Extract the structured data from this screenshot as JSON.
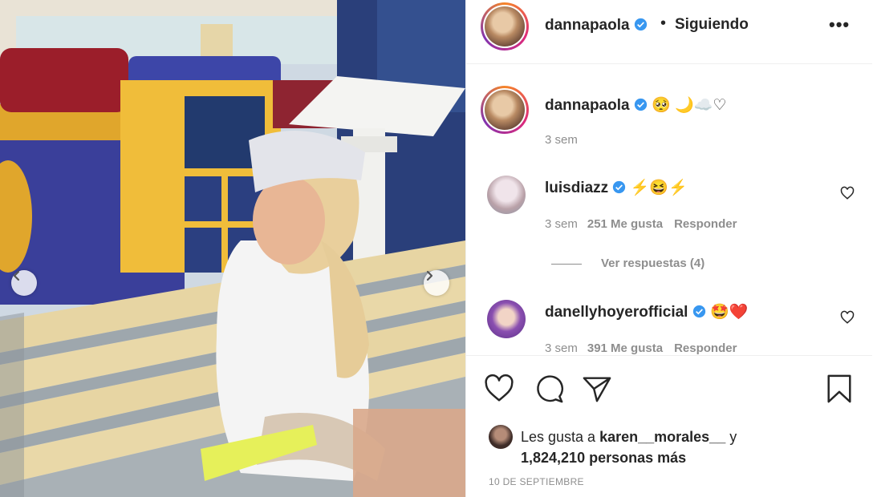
{
  "post": {
    "username": "dannapaola",
    "follow_status": "Siguiendo",
    "separator": "•",
    "more": "•••"
  },
  "caption": {
    "username": "dannapaola",
    "text": "🥺 🌙☁️♡",
    "time": "3 sem"
  },
  "comments": [
    {
      "username": "luisdiazz",
      "text": "⚡😆⚡",
      "time": "3 sem",
      "likes": "251 Me gusta",
      "reply": "Responder",
      "replies_label": "Ver respuestas (4)"
    },
    {
      "username": "danellyhoyerofficial",
      "text": "🤩❤️",
      "time": "3 sem",
      "likes": "391 Me gusta",
      "reply": "Responder"
    }
  ],
  "likes": {
    "prefix": "Les gusta a",
    "user": "karen__morales__",
    "conj": "y",
    "count": "1,824,210 personas más"
  },
  "date": "10 DE SEPTIEMBRE",
  "icons": [
    "chevron-left-icon",
    "chevron-right-icon",
    "verified-badge-icon",
    "more-icon",
    "heart-icon",
    "comment-icon",
    "share-icon",
    "bookmark-icon"
  ],
  "colors": {
    "verified": "#3897f0",
    "text": "#262626",
    "muted": "#8e8e8e",
    "border": "#efefef"
  }
}
